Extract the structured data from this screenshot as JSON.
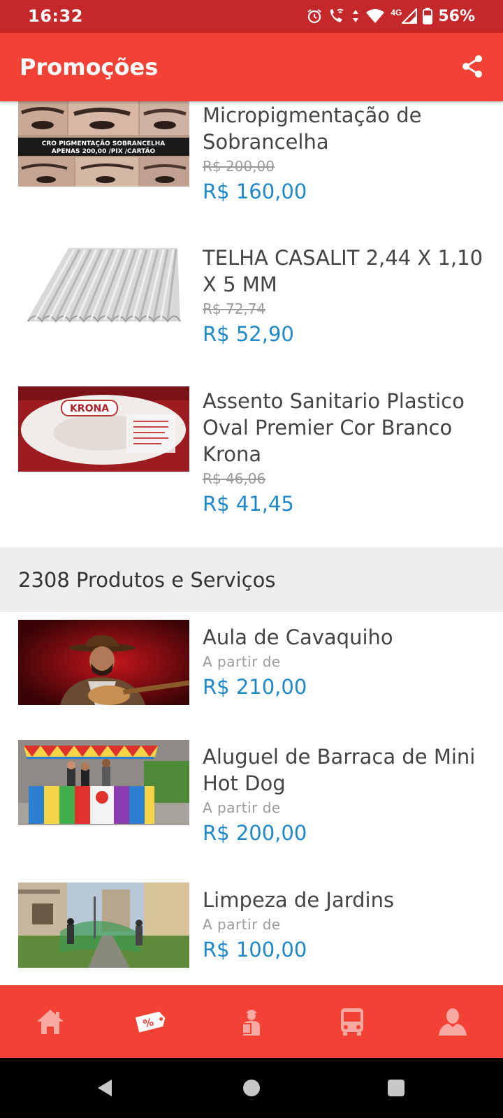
{
  "status_bar": {
    "time": "16:32",
    "network": "4G",
    "battery": "56%",
    "icons": [
      "alarm-icon",
      "wifi-call-icon",
      "data-arrows-icon",
      "wifi-icon",
      "signal-icon",
      "battery-icon"
    ]
  },
  "app_bar": {
    "title": "Promoções",
    "share_icon": "share-icon"
  },
  "promotions": [
    {
      "title": "Micropigmentação de Sobrancelha",
      "old_price": "R$  200,00",
      "price": "R$  160,00",
      "image_text": "CRO PIGMENTAÇÃO SOBRANCELHA APENAS 200,00 /PIX /CARTÃO"
    },
    {
      "title": "TELHA CASALIT   2,44 X 1,10 X 5 MM",
      "old_price": "R$  72,74",
      "price": "R$  52,90"
    },
    {
      "title": "Assento Sanitario Plastico Oval Premier Cor Branco Krona",
      "old_price": "R$  46,06",
      "price": "R$  41,45",
      "image_text": "KRONA"
    }
  ],
  "section": {
    "title": "2308 Produtos e Serviços"
  },
  "products": [
    {
      "title": "Aula de Cavaquiho",
      "from_label": "A partir de",
      "price": "R$  210,00"
    },
    {
      "title": "Aluguel de Barraca de Mini Hot Dog",
      "from_label": "A partir de",
      "price": "R$  200,00"
    },
    {
      "title": "Limpeza de Jardins",
      "from_label": "A partir de",
      "price": "R$  100,00"
    }
  ],
  "bottom_nav": {
    "items": [
      "home-icon",
      "promo-tag-icon",
      "worker-icon",
      "bus-icon",
      "user-icon"
    ],
    "active_color": "#ffffff",
    "inactive_color": "#f8a9a2"
  },
  "colors": {
    "status_bar": "#c5282b",
    "primary": "#f24236",
    "price": "#1e88c8",
    "section_bg": "#eeeeee"
  }
}
